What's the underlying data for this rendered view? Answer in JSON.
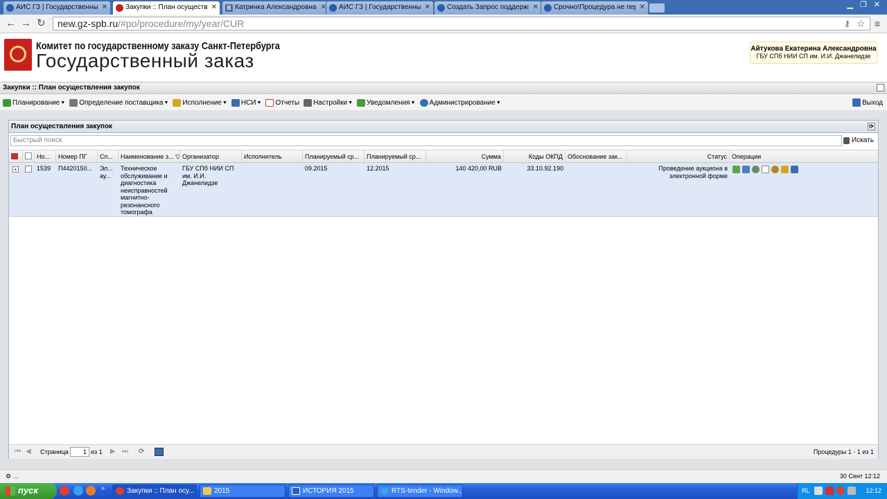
{
  "browser": {
    "tabs": [
      {
        "label": "АИС ГЗ | Государственный",
        "icon": "globe-icon",
        "active": false
      },
      {
        "label": "Закупки :: План осуществ",
        "icon": "gz-icon",
        "active": true
      },
      {
        "label": "Катринка Александровна",
        "icon": "vk-icon",
        "active": false
      },
      {
        "label": "АИС ГЗ | Государственный",
        "icon": "globe-icon",
        "active": false
      },
      {
        "label": "Создать Запрос поддержк",
        "icon": "globe-icon",
        "active": false
      },
      {
        "label": "Срочно!Процедура не пер",
        "icon": "globe-icon",
        "active": false
      }
    ],
    "url_host": "new.gz-spb.ru",
    "url_path": "/#po/procedure/my/year/CUR"
  },
  "header": {
    "org": "Комитет по государственному заказу Санкт-Петербурга",
    "title": "Государственный заказ",
    "user_name": "Айтукова Екатерина Александровна",
    "user_org": "ГБУ СПб НИИ СП им. И.И. Джанелидзе"
  },
  "panel": {
    "breadcrumb": "Закупки :: План осуществления закупок"
  },
  "menu": {
    "items": [
      {
        "label": "Планирование",
        "icon": "planning-icon",
        "color": "#3a9a3a"
      },
      {
        "label": "Определение поставщика",
        "icon": "supplier-icon",
        "color": "#777777"
      },
      {
        "label": "Исполнение",
        "icon": "execution-icon",
        "color": "#d9a520"
      },
      {
        "label": "НСИ",
        "icon": "nsi-icon",
        "color": "#3a6db0"
      },
      {
        "label": "Отчеты",
        "icon": "reports-icon",
        "color": "#c0392b"
      },
      {
        "label": "Настройки",
        "icon": "settings-icon",
        "color": "#666666"
      },
      {
        "label": "Уведомления",
        "icon": "notifications-icon",
        "color": "#4c9a3a"
      },
      {
        "label": "Администрирование",
        "icon": "admin-icon",
        "color": "#3a6db0"
      }
    ],
    "exit": "Выход"
  },
  "grid": {
    "title": "План осуществления закупок",
    "search_placeholder": "Быстрый поиск",
    "search_button": "Искать",
    "columns": [
      "Но...",
      "Номер ПГ",
      "Сп...",
      "Наименование з...",
      "Организатор",
      "Исполнитель",
      "Планируемый ср...",
      "Планируемый ср...",
      "Сумма",
      "Коды ОКПД",
      "Обоснование зак...",
      "Статус",
      "Операции"
    ],
    "rows": [
      {
        "num": "1539",
        "plan_num": "П4420150...",
        "method": "Эл... ау...",
        "name": "Техническое обслуживание и диагностика неисправностей магнитно-резонансного томографа",
        "organizer": "ГБУ СПб НИИ СП им. И.И. Джанелидзе",
        "executor": "",
        "date_start": "09.2015",
        "date_end": "12.2015",
        "sum": "140 420,00 RUB",
        "okpd": "33.10.92.190",
        "basis": "",
        "status": "Проведение аукциона в электронной форме"
      }
    ],
    "operations_icons": [
      "money-icon",
      "chart-icon",
      "group-icon",
      "document-icon",
      "emblem-icon",
      "scroll-icon",
      "stats-icon"
    ]
  },
  "pager": {
    "page_label": "Страница",
    "page_value": "1",
    "of_label": "из 1",
    "summary": "Процедуры 1 - 1 из 1"
  },
  "status": {
    "left": "…",
    "right": "30 Сент 12:12"
  },
  "taskbar": {
    "start": "пуск",
    "tasks": [
      {
        "label": "Закупки :: План осу...",
        "icon": "chrome-icon",
        "active": true
      },
      {
        "label": "2015",
        "icon": "folder-icon",
        "active": false
      },
      {
        "label": "ИСТОРИЯ 2015",
        "icon": "word-icon",
        "active": false
      },
      {
        "label": "RTS-tender - Window...",
        "icon": "ie-icon",
        "active": false
      }
    ],
    "lang": "RL",
    "clock": "12:12"
  }
}
